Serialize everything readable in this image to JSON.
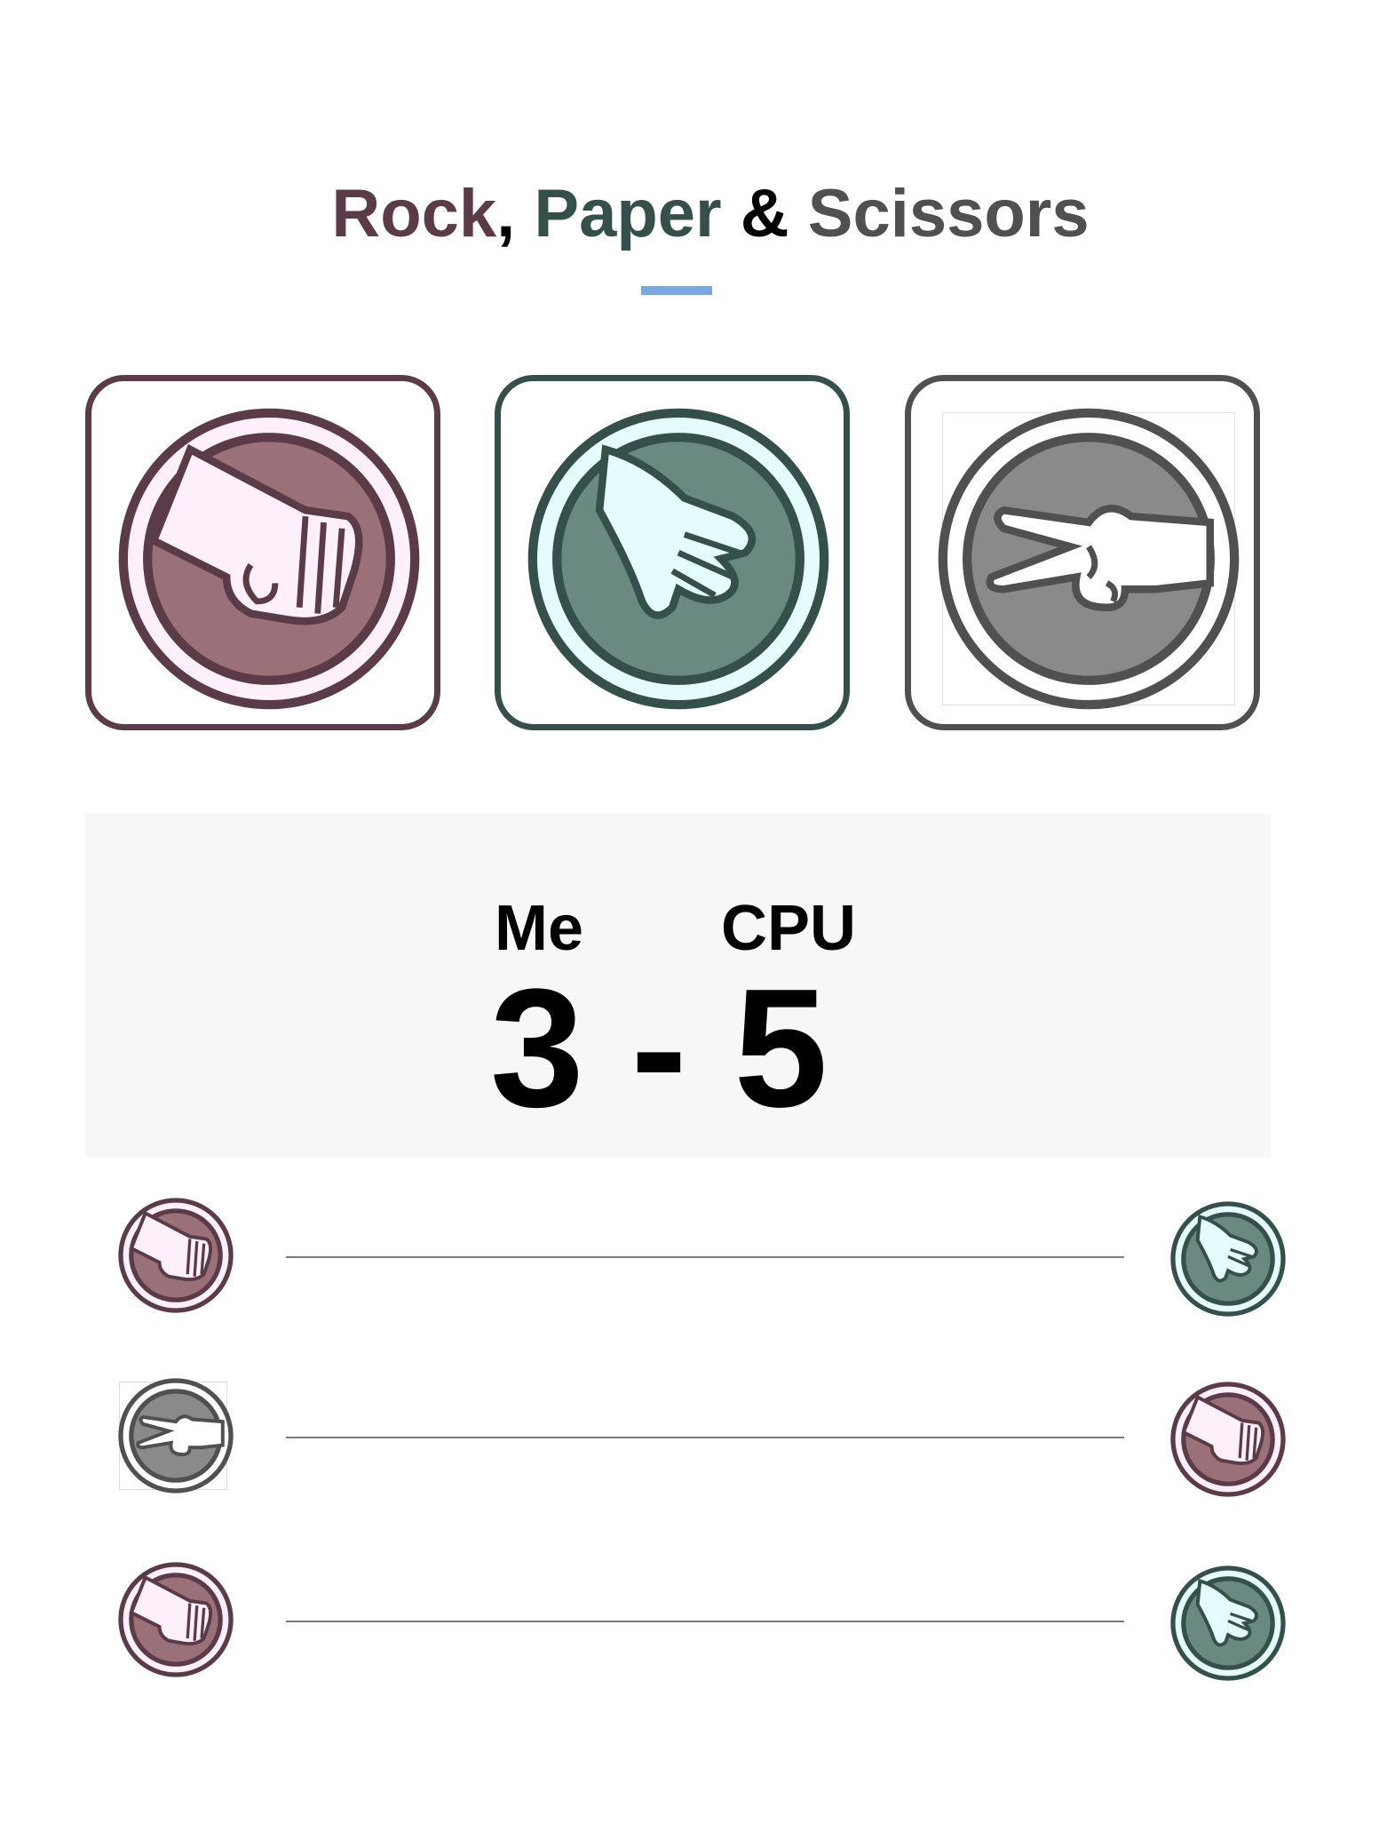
{
  "title": {
    "word1": "Rock",
    "sep1": ", ",
    "word2": "Paper",
    "sep2": " & ",
    "word3": "Scissors",
    "colors": {
      "rock": "#5a3b47",
      "paper": "#35504b",
      "amp": "#000000",
      "scissors": "#505050"
    }
  },
  "choices": [
    {
      "name": "rock",
      "icon": "rock-icon",
      "color": "#5a3b47"
    },
    {
      "name": "paper",
      "icon": "paper-icon",
      "color": "#35504b"
    },
    {
      "name": "scissors",
      "icon": "scissors-icon",
      "color": "#505050"
    }
  ],
  "scoreboard": {
    "me_label": "Me",
    "cpu_label": "CPU",
    "score": "3 - 5",
    "me_score": 3,
    "cpu_score": 5
  },
  "history": [
    {
      "me": "rock",
      "cpu": "paper"
    },
    {
      "me": "scissors",
      "cpu": "rock"
    },
    {
      "me": "rock",
      "cpu": "paper"
    }
  ]
}
